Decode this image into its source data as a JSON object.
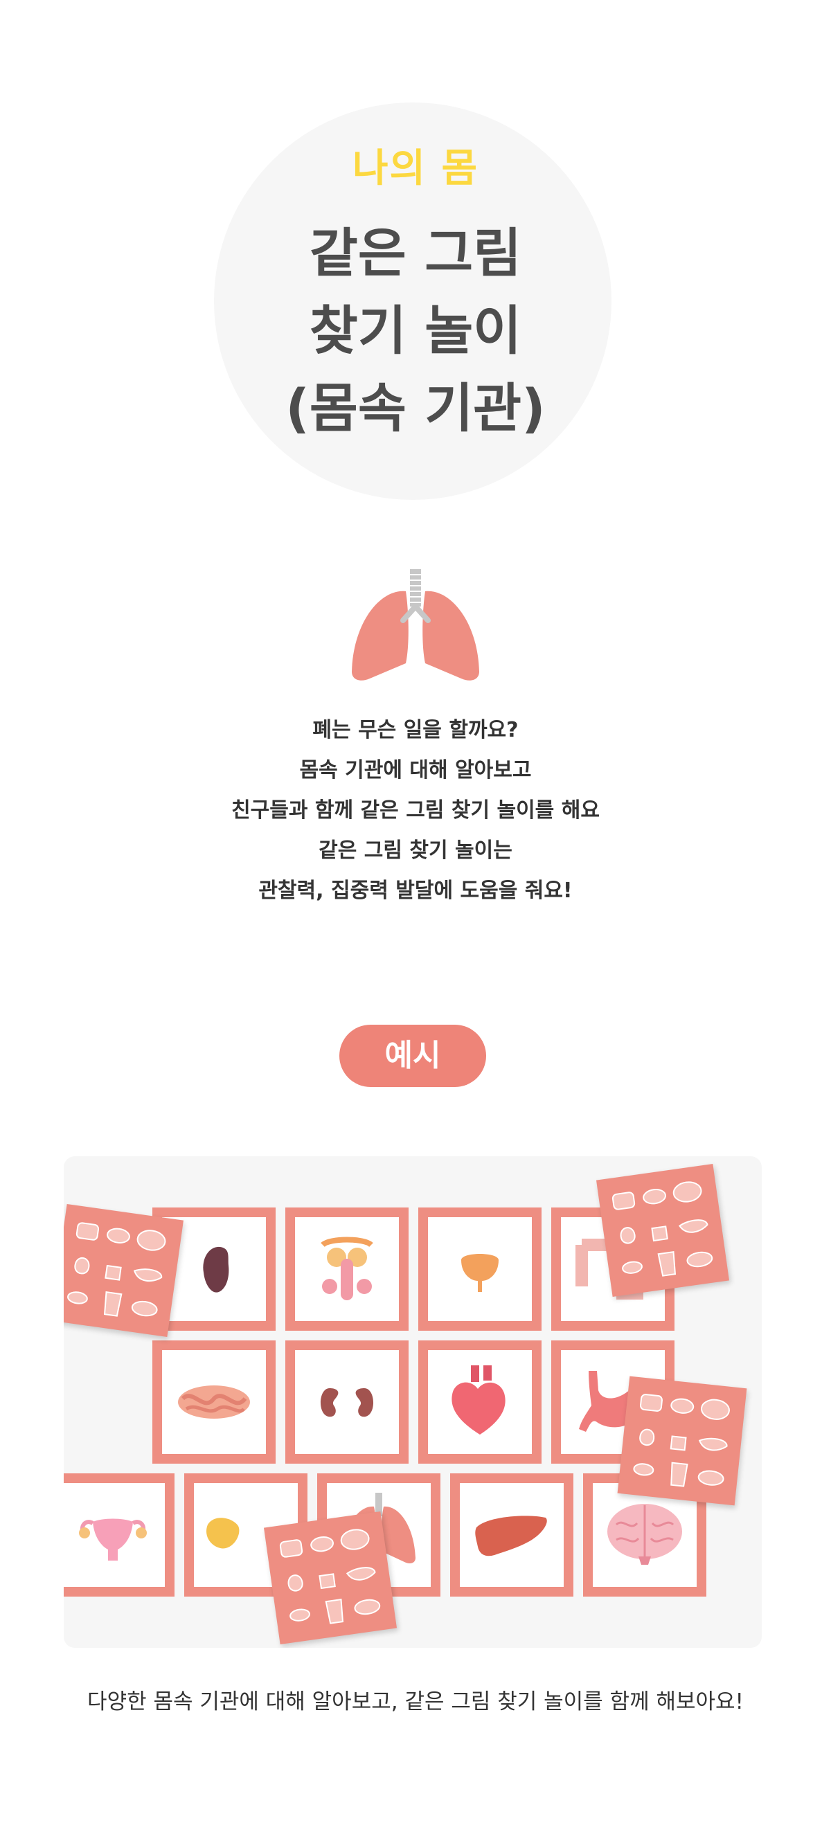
{
  "hero": {
    "label": "나의 몸",
    "title_lines": [
      "같은 그림",
      "찾기 놀이",
      "(몸속 기관)"
    ]
  },
  "description": {
    "lines": [
      "폐는 무슨 일을 할까요?",
      "몸속 기관에 대해 알아보고",
      "친구들과 함께 같은 그림 찾기 놀이를 해요",
      "같은 그림 찾기 놀이는",
      "관찰력, 집중력 발달에 도움을 줘요!"
    ]
  },
  "example": {
    "label": "예시",
    "caption": "다양한 몸속 기관에 대해 알아보고, 같은 그림 찾기 놀이를 함께 해보아요!",
    "cards": [
      "spleen-icon",
      "reproductive-male-icon",
      "bladder-icon",
      "intestine-icon",
      "small-intestine-icon",
      "kidneys-icon",
      "heart-icon",
      "stomach-icon",
      "uterus-icon",
      "pancreas-icon",
      "lungs-icon",
      "liver-icon",
      "brain-icon"
    ]
  },
  "colors": {
    "accent": "#ee8478",
    "title_yellow": "#fcd840",
    "title_gray": "#4d4d4d",
    "hero_bg": "#f6f6f6",
    "card_border": "#ee8e82"
  }
}
